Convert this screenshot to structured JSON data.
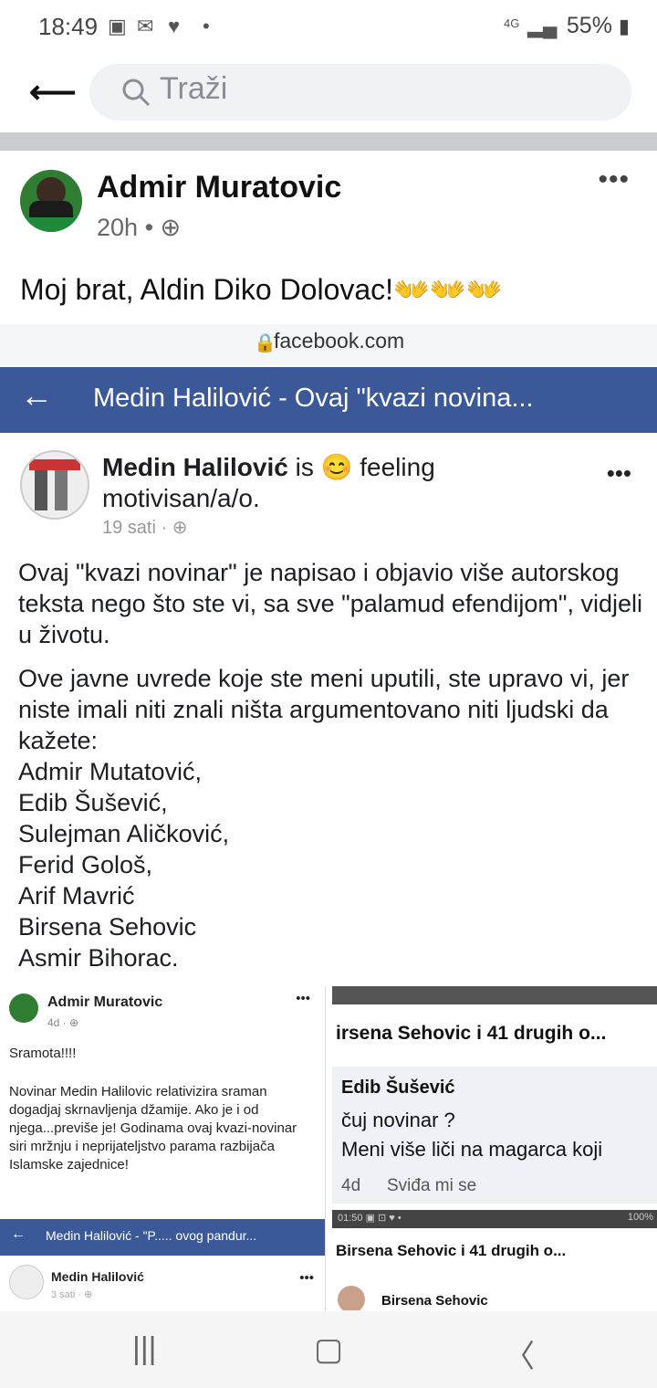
{
  "status_bar": {
    "time": "18:49",
    "network": "4G",
    "battery": "55%"
  },
  "search": {
    "placeholder": "Traži"
  },
  "post": {
    "author": "Admir Muratovic",
    "time": "20h",
    "text": "Moj brat, Aldin Diko Dolovac!👐👐👐"
  },
  "embed": {
    "url": "facebook.com",
    "bar_title": "Medin Halilović - Ovaj \"kvazi novina...",
    "author": "Medin Halilović",
    "feeling": "is 😊 feeling motivisan/a/o.",
    "time": "19 sati · ",
    "p1": "Ovaj \"kvazi novinar\" je napisao i objavio više autorskog teksta nego što ste vi, sa sve \"palamud efendijom\", vidjeli u životu.",
    "p2": "Ove javne uvrede koje ste meni uputili, ste upravo vi, jer niste imali niti znali ništa argumentovano niti ljudski da kažete:",
    "names": [
      "Admir Mutatović,",
      "Edib Šušević,",
      "Sulejman Aličković,",
      "Ferid Gološ,",
      "Arif Mavrić",
      "Birsena Sehovic",
      "Asmir Bihorac."
    ]
  },
  "left_shot": {
    "author": "Admir Muratovic",
    "time": "4d · ",
    "line1": "Sramota!!!!",
    "text": "Novinar Medin Halilovic relativizira sraman dogadjaj skrnavljenja džamije. Ako je i od njega...previše je! Godinama ovaj kvazi-novinar siri mržnju i neprijateljstvo parama razbijača Islamske zajednice!",
    "bar": "Medin Halilović - \"P..... ovog pandur...",
    "author2": "Medin Halilović",
    "time2": "3 sati · "
  },
  "right_shot": {
    "header": "irsena Sehovic i 41 drugih o...",
    "commenter": "Edib Šušević",
    "c1": "čuj novinar ?",
    "c2": "Meni više liči na magarca koji",
    "age": "4d",
    "like": "Sviđa mi se",
    "status": "01:50 ▣ ⊡ ♥ •",
    "batt": "100%",
    "header2": "Birsena Sehovic i 41 drugih o...",
    "commenter2": "Birsena Sehovic"
  }
}
